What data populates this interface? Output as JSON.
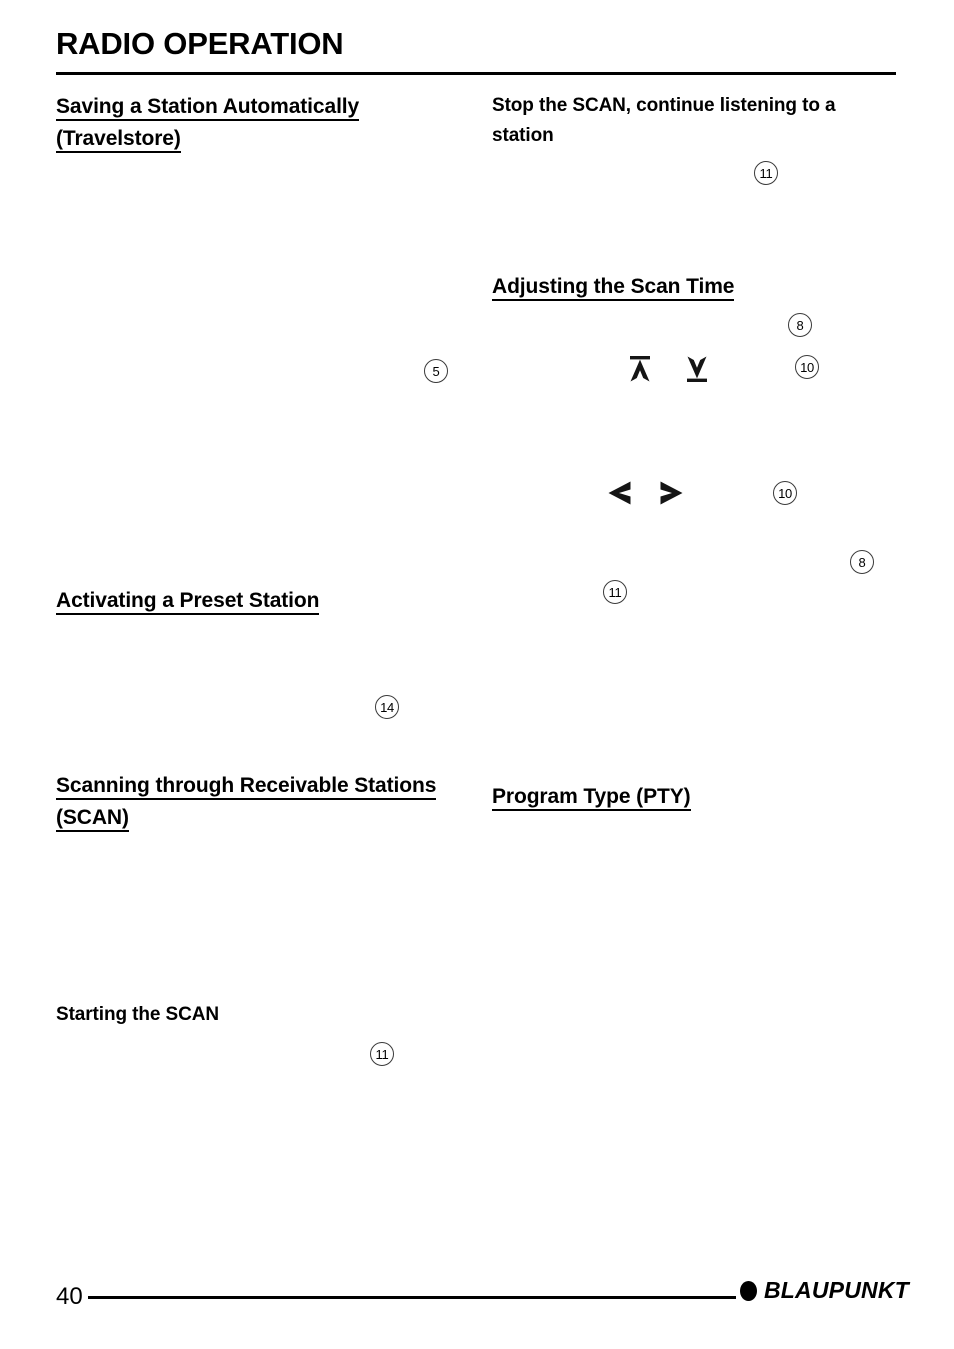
{
  "document": {
    "title": "RADIO OPERATION"
  },
  "left_column": {
    "headings": [
      {
        "id": "travelstore",
        "text": "Saving a Station Automatically (Travelstore)",
        "underlined": true
      },
      {
        "id": "preset",
        "text": "Activating a Preset Station",
        "underlined": true
      },
      {
        "id": "scan",
        "text": "Scanning through Receivable Stations (SCAN)",
        "underlined": true
      }
    ],
    "subheadings": [
      {
        "id": "starting-scan",
        "text": "Starting the SCAN"
      }
    ],
    "badges": [
      {
        "id": "left-badge-5",
        "number": "5"
      },
      {
        "id": "left-badge-14",
        "number": "14"
      },
      {
        "id": "left-badge-11",
        "number": "11"
      }
    ]
  },
  "right_column": {
    "headings": [
      {
        "id": "scan-time",
        "text": "Adjusting the Scan Time",
        "underlined": true
      },
      {
        "id": "pty",
        "text": "Program Type (PTY)",
        "underlined": true
      }
    ],
    "subheadings": [
      {
        "id": "stop-scan",
        "text": "Stop the SCAN, continue listening to a station"
      }
    ],
    "badges": [
      {
        "id": "right-badge-11-top",
        "number": "11"
      },
      {
        "id": "right-badge-8-top",
        "number": "8"
      },
      {
        "id": "right-badge-10-top",
        "number": "10"
      },
      {
        "id": "right-badge-10-mid",
        "number": "10"
      },
      {
        "id": "right-badge-8-mid",
        "number": "8"
      },
      {
        "id": "right-badge-11-mid",
        "number": "11"
      }
    ],
    "glyphs": [
      {
        "id": "arrow-up-bar",
        "name": "arrow-up-bar-icon"
      },
      {
        "id": "arrow-down-bar",
        "name": "arrow-down-bar-icon"
      },
      {
        "id": "arrow-left",
        "name": "arrow-left-icon"
      },
      {
        "id": "arrow-right",
        "name": "arrow-right-icon"
      }
    ]
  },
  "footer": {
    "page_number": "40",
    "brand": "BLAUPUNKT"
  },
  "colors": {
    "text": "#000000",
    "rule": "#000000",
    "badge_border": "#3a3a3a",
    "background": "#ffffff"
  }
}
